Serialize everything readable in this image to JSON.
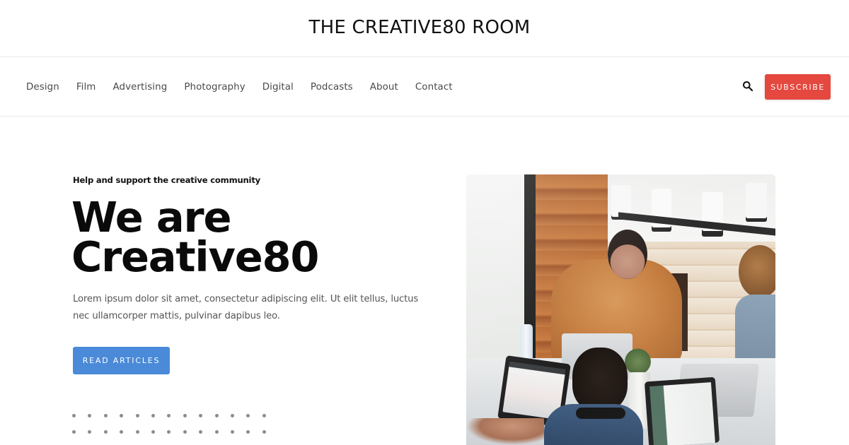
{
  "site": {
    "title": "THE CREATIVE80 ROOM"
  },
  "nav": {
    "items": [
      {
        "label": "Design"
      },
      {
        "label": "Film"
      },
      {
        "label": "Advertising"
      },
      {
        "label": "Photography"
      },
      {
        "label": "Digital"
      },
      {
        "label": "Podcasts"
      },
      {
        "label": "About"
      },
      {
        "label": "Contact"
      }
    ],
    "search_icon": "search-icon",
    "subscribe_label": "SUBSCRIBE"
  },
  "hero": {
    "eyebrow": "Help and support the creative community",
    "title_line1": "We are",
    "title_line2": "Creative80",
    "body": "Lorem ipsum dolor sit amet, consectetur adipiscing elit. Ut elit tellus, luctus nec ullamcorper mattis, pulvinar dapibus leo.",
    "cta_label": "READ ARTICLES",
    "image_description": "People working on laptops around a wooden table",
    "dot_grid": {
      "rows": 2,
      "columns": 13
    }
  },
  "colors": {
    "subscribe": "#e4483f",
    "cta": "#4a8ad8",
    "text": "#111111",
    "muted_text": "#555555",
    "nav_text": "#4a4a4a",
    "divider": "#e8e8e8"
  }
}
